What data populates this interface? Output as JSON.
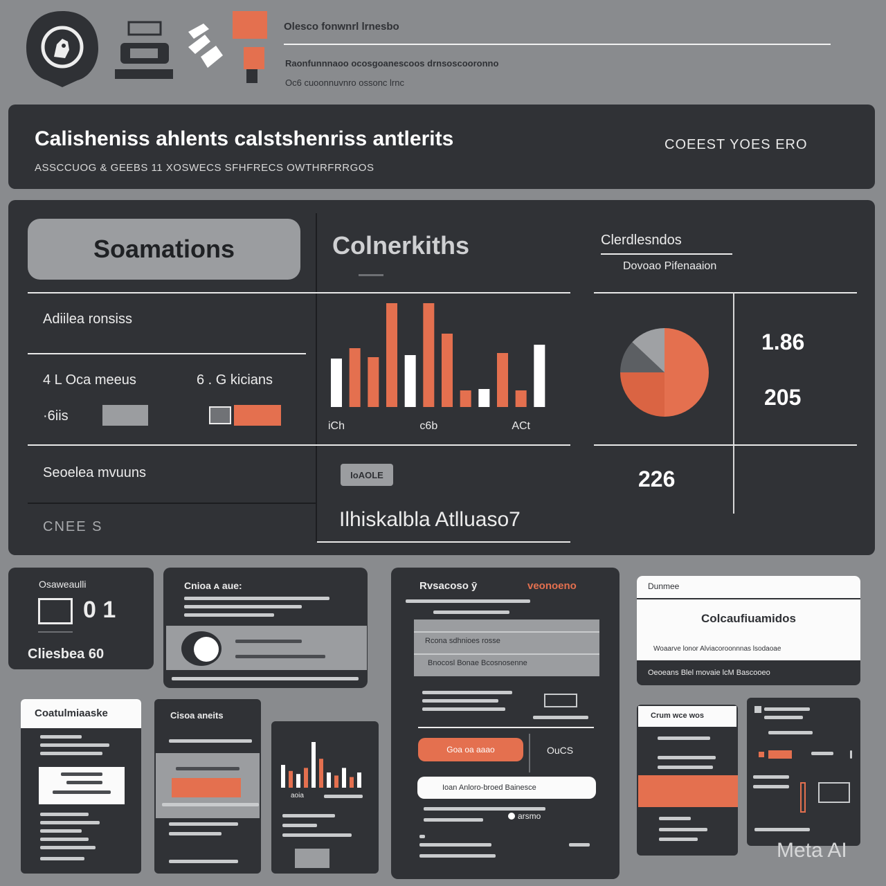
{
  "top": {
    "heading": "Olesco fonwnrl lrnesbo",
    "subline1": "Raonfunnnaoo ocosgoanescoos drnsoscooronno",
    "subline2": "Oc6 cuoonnuvnro ossonc lrnc"
  },
  "banner": {
    "title": "Calisheniss ahlents  calstshenriss antlerits",
    "subtitle": "ASSCCUOG & GEEBS 11 XOSWECS SFHFRECS OWTHRFRRGOS",
    "right_label": "COEEST  YOES ERO"
  },
  "left_panel": {
    "button_label": "Soamations",
    "row1_label": "Adiilea ronsiss",
    "metric1": "4 L Oca meeus",
    "metric2": "6 . G kicians",
    "metric1_sub": "·6iis",
    "row3_label": "Seoelea mvuuns",
    "row4_label": "CNEE   S"
  },
  "bar_panel": {
    "title": "Colnerkiths",
    "tick_labels": [
      "iCh",
      "ᴄ6b",
      "ACt"
    ],
    "badge": "IoAOLE",
    "footer_text": "Ilhiskalbla Atlluaso7"
  },
  "pie_panel": {
    "title": "Clerdlesndos",
    "subtitle": "Dovoao Pifenaaion",
    "value1": "1.86",
    "value2": "205",
    "value3": "226"
  },
  "cards": {
    "c1_title": "Osaweaulli",
    "c1_value": "0 1",
    "c1_footer": "Cliesbea   60",
    "c2_title": "Cnioa ᴀ aue:",
    "c3_title": "Rvsacoso ȳ",
    "c3_title_right": "veonoeno",
    "c3_row1": "Rcona sdhnioes rosse",
    "c3_row2": "Bnocosl Bonae Bcosnosenne",
    "c3_btn_orange": "Goa oa aaao",
    "c3_btn_text": "OuCS",
    "c3_btn_white": "Ioan  Anloro-broed Bainesce",
    "c3_footer": "arsmo",
    "c4_title": "Dunmee",
    "c4_heading": "Colcaufiuamidos",
    "c4_row1": "Woaarve lonor  Alviacoroonnnas  lsodaoae",
    "c4_row2": "Oeoeans   Blel movaie lcM   Bascooeo",
    "c5_title": "Coatulmiaaske",
    "c6_title": "Cisoa aneits",
    "c7_chart_label": "aoia",
    "c8_title": "Crum wce wos",
    "watermark": "Meta AI"
  },
  "chart_data": [
    {
      "type": "bar",
      "title": "Colnerkiths",
      "categories": [
        "iCh",
        "",
        "",
        "",
        "",
        "ᴄ6b",
        "",
        "",
        "",
        "",
        "ACt",
        ""
      ],
      "series": [
        {
          "values": [
            70,
            85,
            72,
            150,
            75,
            150,
            106,
            24,
            26,
            78,
            24,
            90
          ]
        }
      ],
      "colors": [
        "#ffffff",
        "#e4704f",
        "#e4704f",
        "#e4704f",
        "#ffffff",
        "#e4704f",
        "#e4704f",
        "#e4704f",
        "#ffffff",
        "#e4704f",
        "#e4704f",
        "#ffffff"
      ],
      "ylim": [
        0,
        160
      ]
    },
    {
      "type": "pie",
      "title": "Clerdlesndos",
      "values": [
        50,
        25,
        12,
        13
      ],
      "colors": [
        "#e4704f",
        "#da6443",
        "#5c5f63",
        "#9fa1a4"
      ],
      "labels": [
        "",
        "",
        "",
        ""
      ]
    },
    {
      "type": "bar",
      "categories": [
        "",
        "",
        "",
        "",
        "",
        "",
        "",
        "",
        "",
        "",
        ""
      ],
      "series": [
        {
          "values": [
            30,
            22,
            18,
            26,
            60,
            38,
            20,
            16,
            26,
            14,
            20
          ]
        }
      ],
      "colors": [
        "#ffffff",
        "#e4704f",
        "#ffffff",
        "#e4704f",
        "#ffffff",
        "#e4704f",
        "#ffffff",
        "#e4704f",
        "#ffffff",
        "#e4704f",
        "#ffffff"
      ]
    }
  ]
}
